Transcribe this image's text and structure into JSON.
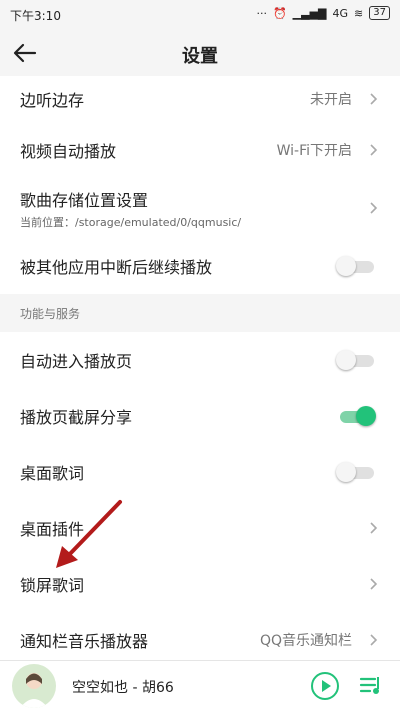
{
  "status": {
    "time": "下午3:10",
    "network": "4G",
    "battery": "37"
  },
  "header": {
    "title": "设置"
  },
  "rows_top": [
    {
      "label": "边听边存",
      "value": "未开启"
    },
    {
      "label": "视频自动播放",
      "value": "Wi-Fi下开启"
    },
    {
      "label": "歌曲存储位置设置",
      "sub": "当前位置：/storage/emulated/0/qqmusic/"
    },
    {
      "label": "被其他应用中断后继续播放",
      "toggle": false
    }
  ],
  "section": {
    "title": "功能与服务"
  },
  "rows_bottom": [
    {
      "label": "自动进入播放页",
      "toggle": false
    },
    {
      "label": "播放页截屏分享",
      "toggle": true
    },
    {
      "label": "桌面歌词",
      "toggle": false
    },
    {
      "label": "桌面插件"
    },
    {
      "label": "锁屏歌词"
    },
    {
      "label": "通知栏音乐播放器",
      "value": "QQ音乐通知栏"
    }
  ],
  "player": {
    "song": "空空如也 - 胡66"
  },
  "colors": {
    "accent": "#22c27a",
    "arrow": "#b31b1b"
  }
}
